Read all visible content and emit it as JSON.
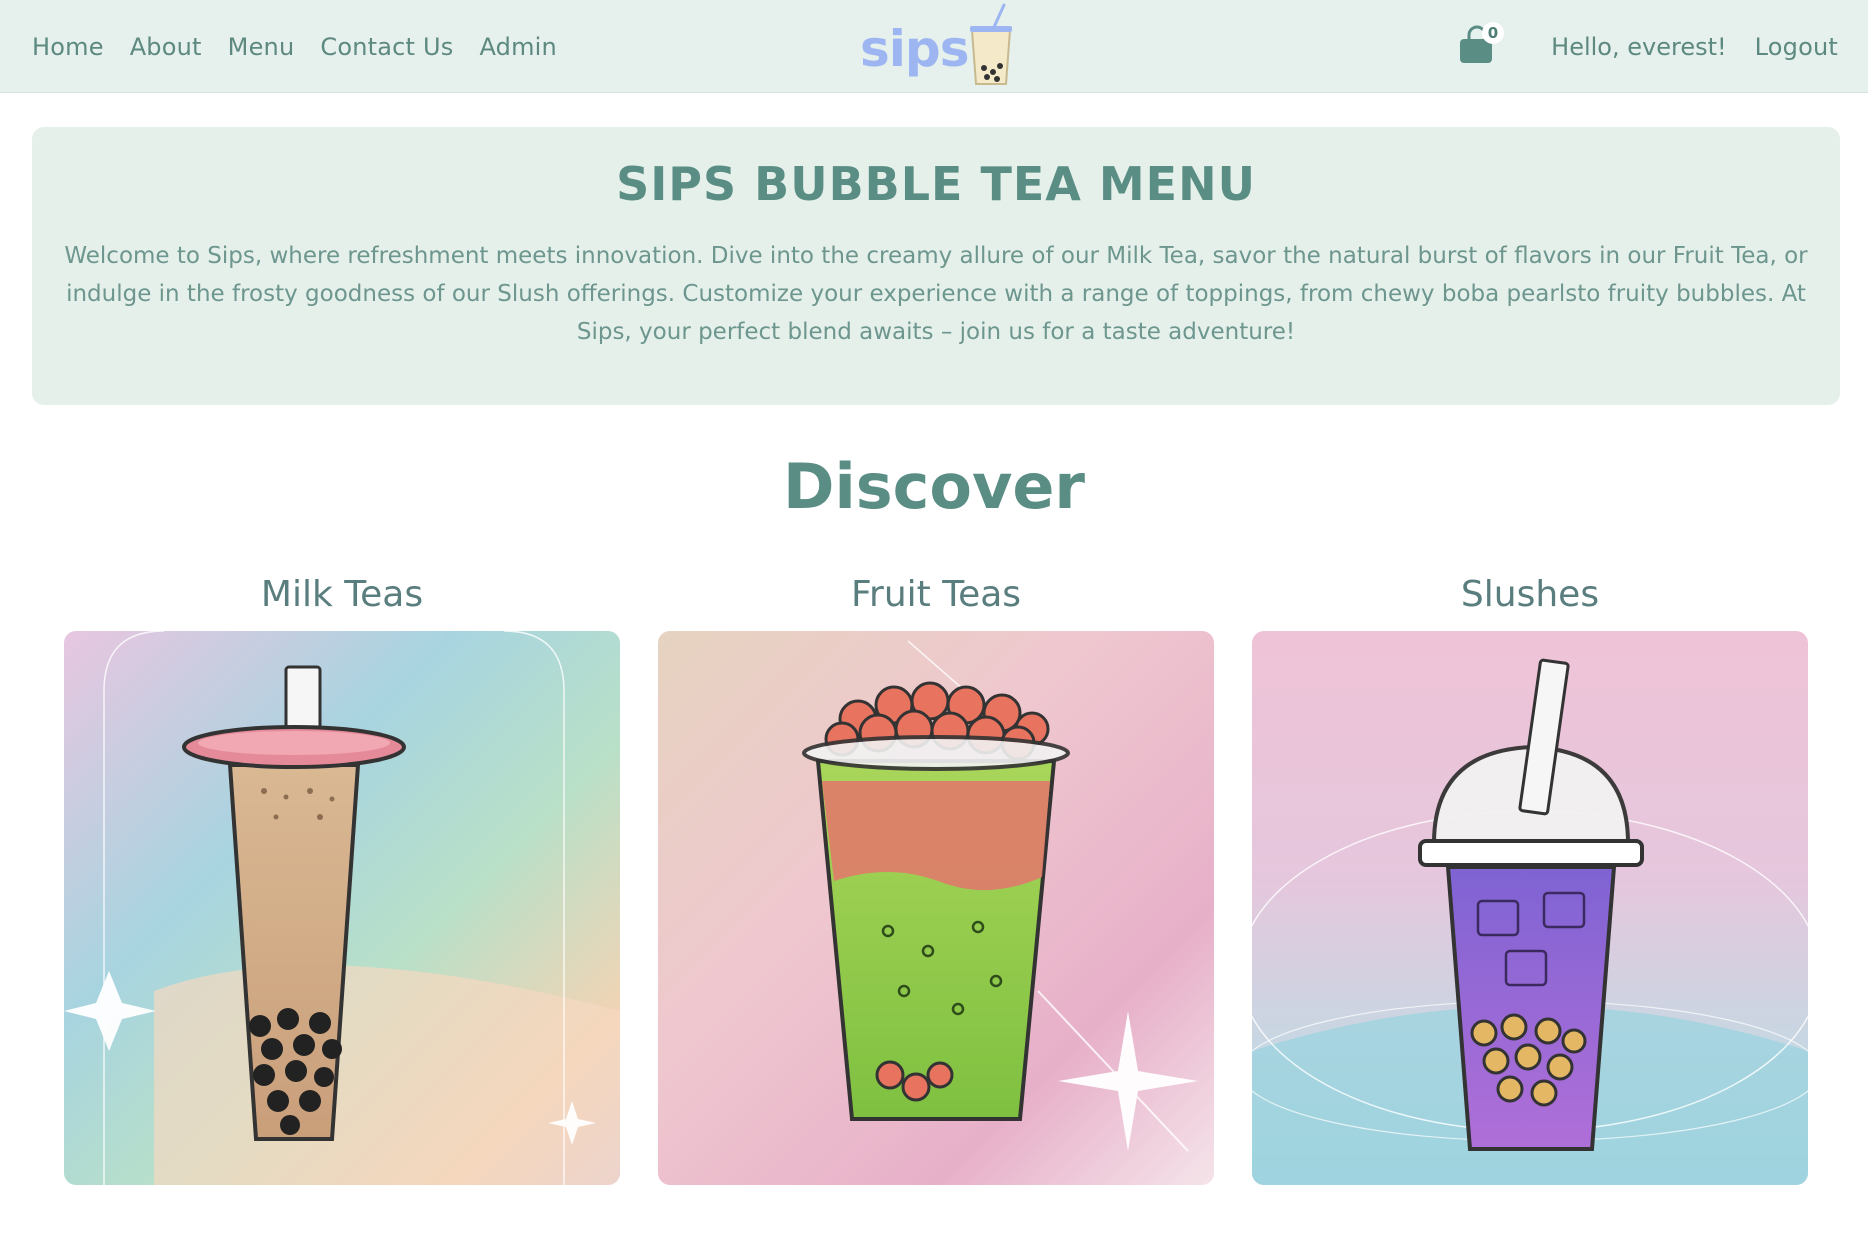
{
  "nav": {
    "links": [
      "Home",
      "About",
      "Menu",
      "Contact Us",
      "Admin"
    ],
    "logo_text": "sips",
    "cart_count": "0",
    "greeting": "Hello, everest!",
    "logout": "Logout"
  },
  "hero": {
    "title": "SIPS BUBBLE TEA MENU",
    "text": "Welcome to Sips, where refreshment meets innovation. Dive into the creamy allure of our Milk Tea, savor the natural burst of flavors in our Fruit Tea, or indulge in the frosty goodness of our Slush offerings. Customize your experience with a range of toppings, from chewy boba pearlsto fruity bubbles. At Sips, your perfect blend awaits – join us for a taste adventure!"
  },
  "discover": {
    "title": "Discover",
    "categories": [
      {
        "label": "Milk Teas",
        "icon": "milk-tea-cup"
      },
      {
        "label": "Fruit Teas",
        "icon": "fruit-tea-cup"
      },
      {
        "label": "Slushes",
        "icon": "slush-cup"
      }
    ]
  },
  "colors": {
    "navbar_bg": "#e6f0ec",
    "accent": "#5a8d84",
    "logo": "#9db6f2"
  }
}
